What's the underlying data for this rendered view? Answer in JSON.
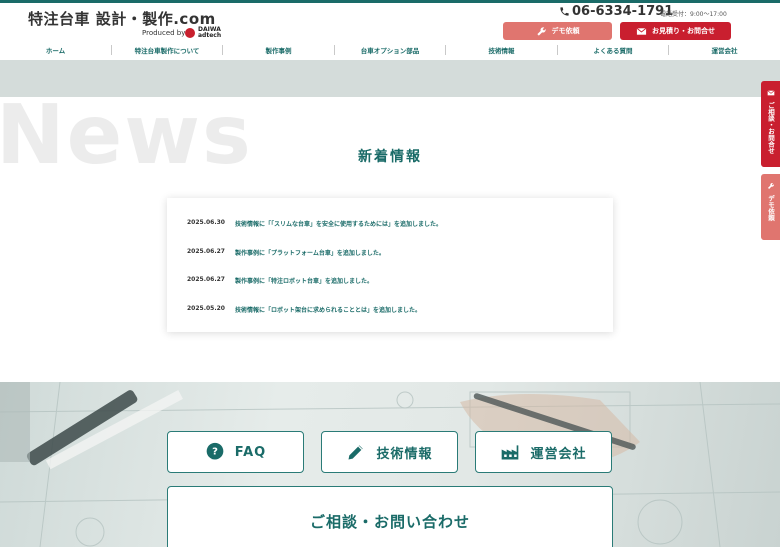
{
  "header": {
    "site_title": "特注台車 設計・製作.com",
    "produced_by": "Produced by",
    "company_logo_text": "DAIWA adtech",
    "phone": "06-6334-1791",
    "hours": "電話受付：9:00〜17:00",
    "demo_button": "デモ依頼",
    "quote_button": "お見積り・お問合せ"
  },
  "nav": {
    "items": [
      {
        "label": "ホーム"
      },
      {
        "label": "特注台車製作について"
      },
      {
        "label": "製作事例"
      },
      {
        "label": "台車オプション部品"
      },
      {
        "label": "技術情報"
      },
      {
        "label": "よくある質問"
      },
      {
        "label": "運営会社"
      }
    ]
  },
  "news": {
    "background_word": "News",
    "title": "新着情報",
    "items": [
      {
        "date": "2025.06.30",
        "text": "技術情報に「「スリムな台車」を安全に使用するためには」を追加しました。"
      },
      {
        "date": "2025.06.27",
        "text": "製作事例に「プラットフォーム台車」を追加しました。"
      },
      {
        "date": "2025.06.27",
        "text": "製作事例に「特注ロボット台車」を追加しました。"
      },
      {
        "date": "2025.05.20",
        "text": "技術情報に「ロボット架台に求められることとは」を追加しました。"
      }
    ]
  },
  "links": {
    "faq": "FAQ",
    "tech": "技術情報",
    "company": "運営会社",
    "contact": "ご相談・お問い合わせ"
  },
  "side": {
    "contact": "ご相談・お問合せ",
    "demo": "デモ依頼"
  },
  "colors": {
    "brand": "#1a6b68",
    "accent_red": "#c91f2f",
    "accent_salmon": "#e0756f"
  },
  "icons": [
    "phone-icon",
    "wrench-icon",
    "mail-icon",
    "question-icon",
    "pen-icon",
    "factory-icon"
  ]
}
